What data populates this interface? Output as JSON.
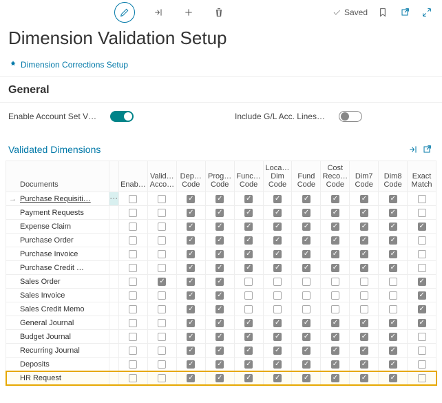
{
  "toolbar": {
    "saved_label": "Saved"
  },
  "page_title": "Dimension Validation Setup",
  "link": "Dimension Corrections Setup",
  "general": {
    "heading": "General",
    "enable_label": "Enable Account Set V…",
    "include_label": "Include G/L Acc. Lines…",
    "enable_value": true,
    "include_value": false
  },
  "validated": {
    "heading": "Validated Dimensions",
    "columns": [
      "Documents",
      "Enab…",
      "Valid… Acco…",
      "Dep… Code",
      "Prog… Code",
      "Func… Code",
      "Loca… Dim Code",
      "Fund Code",
      "Cost Reco… Code",
      "Dim7 Code",
      "Dim8 Code",
      "Exact Match"
    ],
    "rows": [
      {
        "doc": "Purchase Requisiti…",
        "cells": [
          false,
          false,
          true,
          true,
          true,
          true,
          true,
          true,
          true,
          true,
          false
        ]
      },
      {
        "doc": "Payment Requests",
        "cells": [
          false,
          false,
          true,
          true,
          true,
          true,
          true,
          true,
          true,
          true,
          false
        ]
      },
      {
        "doc": "Expense Claim",
        "cells": [
          false,
          false,
          true,
          true,
          true,
          true,
          true,
          true,
          true,
          true,
          true
        ]
      },
      {
        "doc": "Purchase Order",
        "cells": [
          false,
          false,
          true,
          true,
          true,
          true,
          true,
          true,
          true,
          true,
          false
        ]
      },
      {
        "doc": "Purchase Invoice",
        "cells": [
          false,
          false,
          true,
          true,
          true,
          true,
          true,
          true,
          true,
          true,
          false
        ]
      },
      {
        "doc": "Purchase Credit …",
        "cells": [
          false,
          false,
          true,
          true,
          true,
          true,
          true,
          true,
          true,
          true,
          false
        ]
      },
      {
        "doc": "Sales Order",
        "cells": [
          false,
          true,
          true,
          true,
          false,
          false,
          false,
          false,
          false,
          false,
          true
        ]
      },
      {
        "doc": "Sales Invoice",
        "cells": [
          false,
          false,
          true,
          true,
          false,
          false,
          false,
          false,
          false,
          false,
          true
        ]
      },
      {
        "doc": "Sales Credit Memo",
        "cells": [
          false,
          false,
          true,
          true,
          false,
          false,
          false,
          false,
          false,
          false,
          true
        ]
      },
      {
        "doc": "General Journal",
        "cells": [
          false,
          false,
          true,
          true,
          true,
          true,
          true,
          true,
          true,
          true,
          true
        ]
      },
      {
        "doc": "Budget Journal",
        "cells": [
          false,
          false,
          true,
          true,
          true,
          true,
          true,
          true,
          true,
          true,
          false
        ]
      },
      {
        "doc": "Recurring Journal",
        "cells": [
          false,
          false,
          true,
          true,
          true,
          true,
          true,
          true,
          true,
          true,
          false
        ]
      },
      {
        "doc": "Deposits",
        "cells": [
          false,
          false,
          true,
          true,
          true,
          true,
          true,
          true,
          true,
          true,
          false
        ]
      },
      {
        "doc": "HR Request",
        "cells": [
          false,
          false,
          true,
          true,
          true,
          true,
          true,
          true,
          true,
          true,
          false
        ]
      }
    ]
  }
}
